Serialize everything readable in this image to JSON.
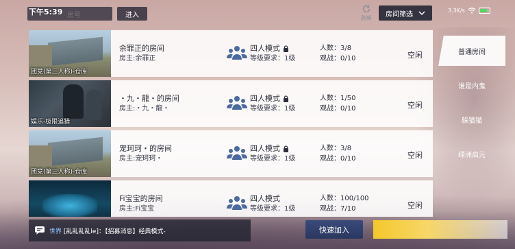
{
  "status_bar": {
    "time": "下午5:39",
    "network_speed": "3.3K/s"
  },
  "top_bar": {
    "search_placeholder": "房号",
    "enter_label": "进入",
    "refresh_label": "刷新",
    "filter_label": "房间筛选"
  },
  "rooms": [
    {
      "thumb_label": "团竞(第三人称)-仓库",
      "name": "余罪正的房间",
      "host": "房主:余罪正",
      "mode": "四人模式",
      "level_req": "等级要求：1级",
      "players": "人数：3/8",
      "spectators": "观战：0/10",
      "status": "空闲",
      "locked": true
    },
    {
      "thumb_label": "娱乐-极限追猎",
      "name": "・九・龍・的房间",
      "host": "房主:・九・龍・",
      "mode": "四人模式",
      "level_req": "等级要求：1级",
      "players": "人数：1/50",
      "spectators": "观战：0/10",
      "status": "空闲",
      "locked": true
    },
    {
      "thumb_label": "团竞(第三人称)-仓库",
      "name": "宠珂珂・的房间",
      "host": "房主:宠珂珂・",
      "mode": "四人模式",
      "level_req": "等级要求：1级",
      "players": "人数：3/8",
      "spectators": "观战：0/10",
      "status": "空闲",
      "locked": true
    },
    {
      "thumb_label": "",
      "name": "Fi宝宝的房间",
      "host": "房主:Fi宝宝",
      "mode": "四人模式",
      "level_req": "等级要求：1级",
      "players": "人数：100/100",
      "spectators": "观战：7/10",
      "status": "空闲",
      "locked": false
    }
  ],
  "side_tabs": [
    {
      "label": "普通房间",
      "active": true
    },
    {
      "label": "谁是内鬼",
      "active": false
    },
    {
      "label": "躲猫猫",
      "active": false
    },
    {
      "label": "绿洲启元",
      "active": false
    }
  ],
  "chat": {
    "channel": "世界",
    "message": "[乱乱乱乱le]：【招募消息】经典模式-"
  },
  "bottom": {
    "quick_join_label": "快速加入"
  },
  "colors": {
    "accent_yellow": "#f4c82c",
    "panel_dark": "#23263a",
    "chat_channel": "#8fc6ff"
  }
}
